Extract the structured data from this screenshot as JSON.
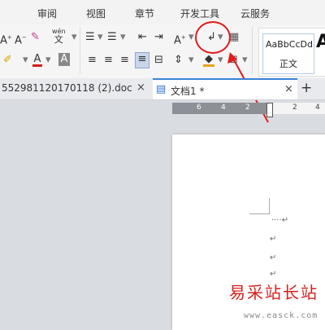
{
  "menu": [
    "审阅",
    "视图",
    "章节",
    "开发工具",
    "云服务"
  ],
  "ribbon": {
    "row1_icons": [
      "font-grow-icon",
      "font-shrink-icon",
      "clear-format-icon",
      "phonetic-guide-icon",
      "bullets-icon",
      "numbering-icon",
      "outdent-icon",
      "indent-icon",
      "char-shading-icon",
      "paragraph-mark-icon",
      "table-icon"
    ],
    "phonetic_top": "wén",
    "phonetic_bottom": "文",
    "char_shading_glyph": "A",
    "row2_icons": [
      "highlight-icon",
      "font-color-icon",
      "char-border-icon",
      "align-left-icon",
      "align-center-icon",
      "align-right-icon",
      "justify-icon",
      "distributed-icon",
      "line-spacing-icon",
      "fill-icon",
      "borders-icon"
    ],
    "font_color_glyph": "A",
    "border_glyph": "A",
    "styles": {
      "preview": "AaBbCcDd",
      "name": "正文",
      "next_preview": "A"
    }
  },
  "tabs": {
    "inactive_label": "552981120170118 (2).doc",
    "active_label": "文档1 *",
    "close_glyph": "×",
    "new_tab_glyph": "+"
  },
  "ruler": {
    "ticks_left": [
      "6",
      "4",
      "2"
    ],
    "ticks_right": [
      "2",
      "4"
    ]
  },
  "document": {
    "lines": [
      "····↵",
      "↵",
      "↵",
      "↵"
    ]
  },
  "annotation": {
    "color": "#e01b1b"
  },
  "watermark": {
    "title": "易采站长站",
    "url": "www.easck.com"
  }
}
